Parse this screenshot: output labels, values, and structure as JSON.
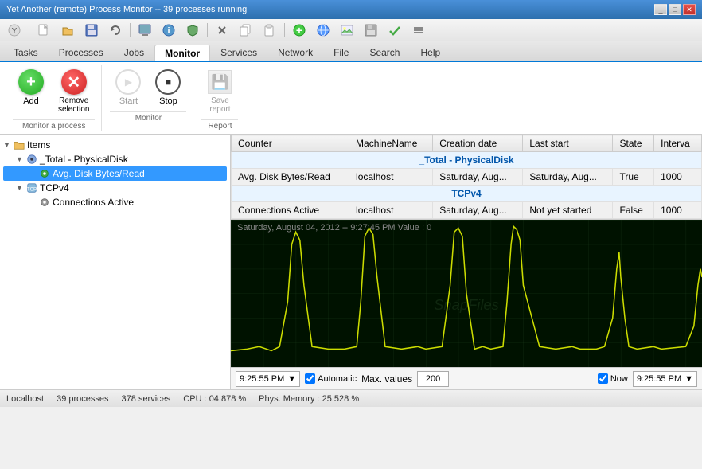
{
  "titleBar": {
    "title": "Yet Another (remote) Process Monitor -- 39 processes running",
    "controls": [
      "minimize",
      "maximize",
      "close"
    ]
  },
  "menuIcons": [
    "new",
    "open",
    "save",
    "undo",
    "add-process",
    "info",
    "shield",
    "cut",
    "copy",
    "paste",
    "separator",
    "add-green",
    "globe",
    "image",
    "floppy",
    "check",
    "menu"
  ],
  "navTabs": [
    {
      "label": "Tasks",
      "active": false
    },
    {
      "label": "Processes",
      "active": false
    },
    {
      "label": "Jobs",
      "active": false
    },
    {
      "label": "Monitor",
      "active": true
    },
    {
      "label": "Services",
      "active": false
    },
    {
      "label": "Network",
      "active": false
    },
    {
      "label": "File",
      "active": false
    },
    {
      "label": "Search",
      "active": false
    },
    {
      "label": "Help",
      "active": false
    }
  ],
  "toolbar": {
    "groups": [
      {
        "label": "Monitor a process",
        "buttons": [
          {
            "id": "add",
            "label": "Add",
            "icon": "add-green-circle",
            "enabled": true
          },
          {
            "id": "remove-selection",
            "label": "Remove\nselection",
            "icon": "remove-red-circle",
            "enabled": true
          }
        ]
      },
      {
        "label": "Monitor",
        "buttons": [
          {
            "id": "start",
            "label": "Start",
            "icon": "play-circle",
            "enabled": false
          },
          {
            "id": "stop",
            "label": "Stop",
            "icon": "stop-circle",
            "enabled": true
          }
        ]
      },
      {
        "label": "Report",
        "buttons": [
          {
            "id": "save-report",
            "label": "Save\nreport",
            "icon": "save-rect",
            "enabled": false
          }
        ]
      }
    ]
  },
  "tree": {
    "label": "Items",
    "items": [
      {
        "id": "total-physical-disk",
        "label": "_Total - PhysicalDisk",
        "indent": 1,
        "expanded": true,
        "children": [
          {
            "id": "avg-disk-bytes-read",
            "label": "Avg. Disk Bytes/Read",
            "indent": 2,
            "selected": true
          }
        ]
      },
      {
        "id": "tcpv4",
        "label": "TCPv4",
        "indent": 1,
        "expanded": true,
        "children": [
          {
            "id": "connections-active",
            "label": "Connections Active",
            "indent": 2,
            "selected": false
          }
        ]
      }
    ]
  },
  "table": {
    "columns": [
      "Counter",
      "MachineName",
      "Creation date",
      "Last start",
      "State",
      "Interva"
    ],
    "groups": [
      {
        "groupLabel": "_Total - PhysicalDisk",
        "rows": [
          {
            "counter": "Avg. Disk Bytes/Read",
            "machineName": "localhost",
            "creationDate": "Saturday, Aug...",
            "lastStart": "Saturday, Aug...",
            "state": "True",
            "interval": "1000"
          }
        ]
      },
      {
        "groupLabel": "TCPv4",
        "rows": [
          {
            "counter": "Connections Active",
            "machineName": "localhost",
            "creationDate": "Saturday, Aug...",
            "lastStart": "Not yet started",
            "state": "False",
            "interval": "1000"
          }
        ]
      }
    ]
  },
  "chart": {
    "label": "Saturday, August 04, 2012 -- 9:27:45 PM  Value : 0",
    "startTime": "9:25:55 PM",
    "endTime": "9:25:55 PM",
    "automatic": true,
    "automaticLabel": "Automatic",
    "maxValuesLabel": "Max. values",
    "maxValues": "200",
    "nowChecked": true,
    "nowLabel": "Now"
  },
  "statusBar": {
    "host": "Localhost",
    "processes": "39 processes",
    "services": "378 services",
    "cpu": "CPU : 04.878 %",
    "memory": "Phys. Memory : 25.528 %"
  }
}
